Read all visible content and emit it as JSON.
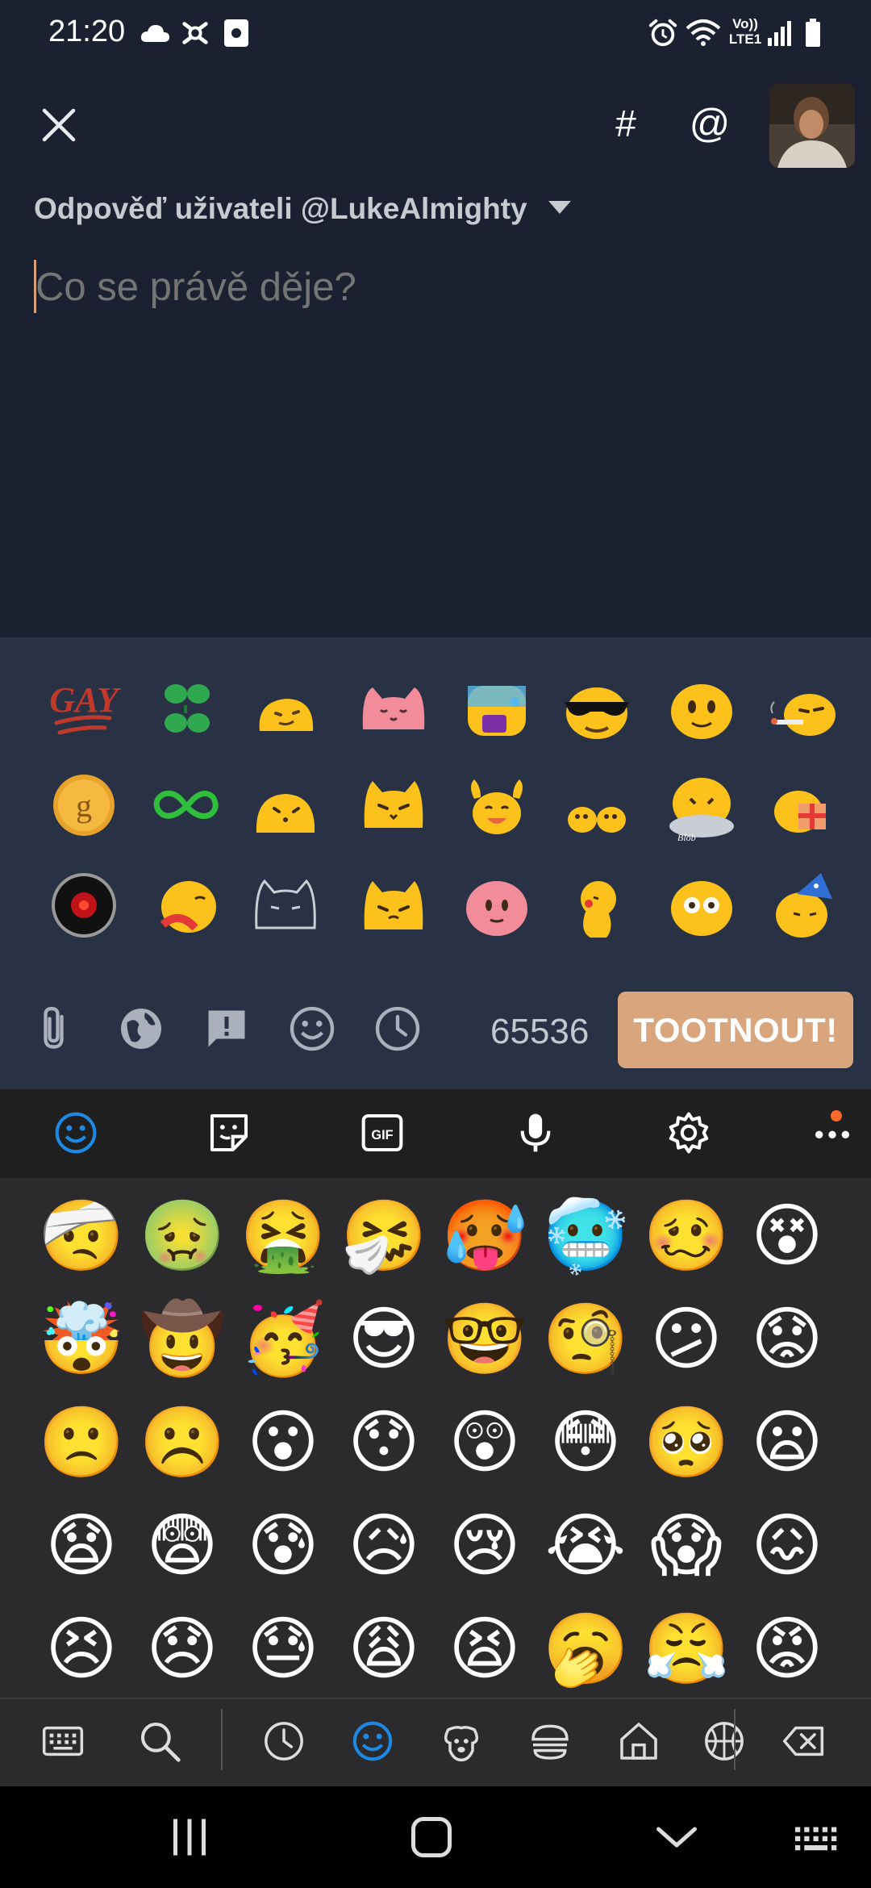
{
  "status_bar": {
    "time": "21:20",
    "carrier_label_top": "Vo))",
    "carrier_label_bottom": "LTE1"
  },
  "compose": {
    "hashtag_label": "#",
    "mention_label": "@",
    "reply_to": "Odpověď uživateli @LukeAlmighty",
    "placeholder": "Co se právě děje?",
    "char_count": "65536",
    "toot_label": "TOOTNOUT!"
  },
  "custom_emoji": {
    "gay_text": "GAY",
    "g_text": "g",
    "blob_text": "Blob"
  },
  "keyboard": {
    "emojis": [
      [
        "🤕",
        "🤢",
        "🤮",
        "🤧",
        "🥵",
        "🥶",
        "🥴",
        "😵"
      ],
      [
        "🤯",
        "🤠",
        "🥳",
        "😎",
        "🤓",
        "🧐",
        "😕",
        "😟"
      ],
      [
        "🙁",
        "☹️",
        "😮",
        "😯",
        "😲",
        "😳",
        "🥺",
        "😦"
      ],
      [
        "😧",
        "😨",
        "😰",
        "😥",
        "😢",
        "😭",
        "😱",
        "😖"
      ],
      [
        "😣",
        "😞",
        "😓",
        "😩",
        "😫",
        "🥱",
        "😤",
        "😡"
      ]
    ]
  },
  "colors": {
    "app_bg": "#1b2130",
    "emoji_panel_bg": "#283244",
    "accent": "#d9a57c",
    "keyboard_bg": "#2b2b2d",
    "keyboard_accent": "#1e88e5"
  },
  "icons": {
    "status": [
      "cloud-icon",
      "app-icon",
      "screenshot-icon",
      "alarm-icon",
      "wifi-icon",
      "signal-icon",
      "battery-icon"
    ],
    "compose_toolbar": [
      "attach-icon",
      "globe-icon",
      "content-warning-icon",
      "emoji-icon",
      "schedule-icon"
    ],
    "keyboard_top": [
      "emoji-icon",
      "sticker-icon",
      "gif-icon",
      "mic-icon",
      "settings-icon",
      "more-icon"
    ],
    "keyboard_bottom": [
      "keyboard-icon",
      "search-icon",
      "recent-icon",
      "smiley-icon",
      "animal-icon",
      "food-icon",
      "home-icon",
      "sports-icon",
      "backspace-icon"
    ]
  }
}
